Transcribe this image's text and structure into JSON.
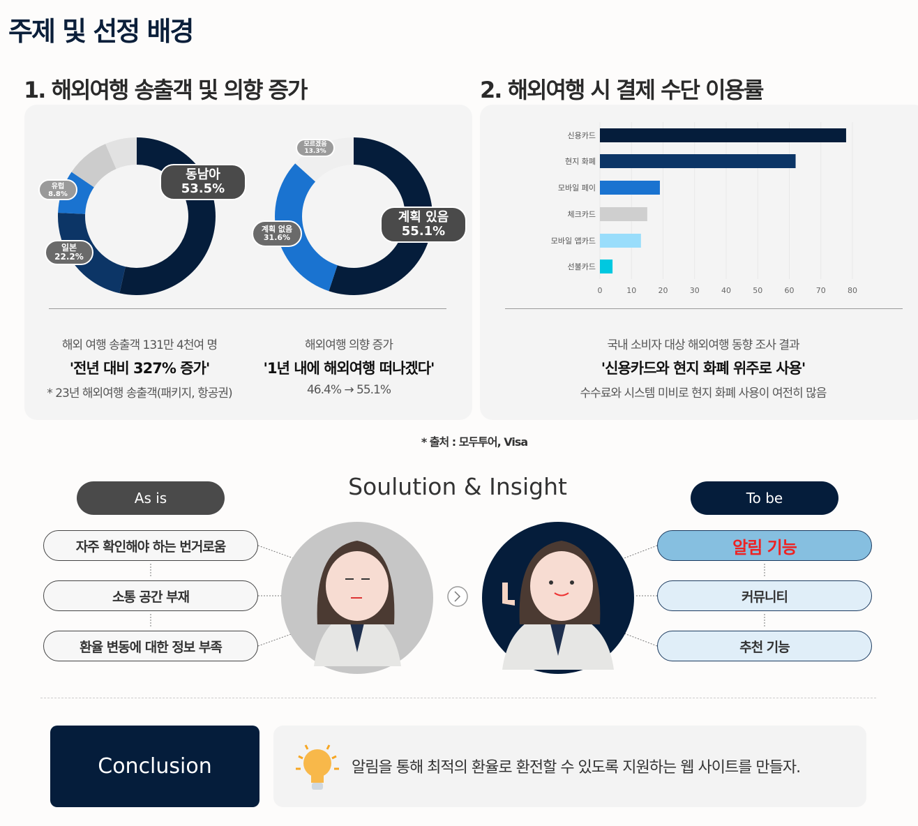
{
  "title": "주제 및 선정 배경",
  "section1": {
    "heading": "1. 해외여행 송출객 및 의향 증가",
    "left_caption": "해외 여행 송출객 131만 4천여 명",
    "left_highlight": "'전년 대비 327% 증가'",
    "left_note": "* 23년 해외여행 송출객(패키지, 항공권)",
    "right_caption": "해외여행 의향 증가",
    "right_highlight": "'1년 내에 해외여행 떠나겠다'",
    "right_note": "46.4% → 55.1%"
  },
  "section2": {
    "heading": "2. 해외여행 시 결제 수단 이용률",
    "caption": "국내 소비자 대상 해외여행 동향 조사 결과",
    "highlight": "'신용카드와 현지 화폐 위주로 사용'",
    "note": "수수료와 시스템 미비로 현지 화폐 사용이 여전히 많음"
  },
  "source": "* 출처 : 모두투어, Visa",
  "chart_data": [
    {
      "type": "pie",
      "donut": true,
      "labels": [
        "동남아",
        "일본",
        "유럽",
        "",
        ""
      ],
      "values": [
        53.5,
        22.2,
        8.8,
        9,
        6.5
      ],
      "value_labels": [
        "53.5%",
        "22.2%",
        "8.8%",
        "",
        ""
      ],
      "colors": [
        "#051d3b",
        "#0c3566",
        "#1a73d0",
        "#cccccc",
        "#e2e2e2"
      ]
    },
    {
      "type": "pie",
      "donut": true,
      "labels": [
        "계획 있음",
        "계획 없음",
        "모르겠음"
      ],
      "values": [
        55.1,
        31.6,
        13.3
      ],
      "value_labels": [
        "55.1%",
        "31.6%",
        "13.3%"
      ],
      "colors": [
        "#051d3b",
        "#1a73d0",
        "#efefef"
      ]
    },
    {
      "type": "bar",
      "orientation": "horizontal",
      "categories": [
        "신용카드",
        "현지 화폐",
        "모바일 페이",
        "체크카드",
        "모바일 앱카드",
        "선불카드"
      ],
      "values": [
        78,
        62,
        19,
        15,
        13,
        4
      ],
      "colors": [
        "#051d3b",
        "#0c3566",
        "#1a73d0",
        "#cfcfcf",
        "#99ddfb",
        "#00c8e0"
      ],
      "xlim": [
        0,
        80
      ],
      "xticks": [
        "0",
        "10",
        "20",
        "30",
        "40",
        "50",
        "60",
        "70",
        "80"
      ],
      "grid": true
    }
  ],
  "insight": {
    "title": "Soulution & Insight",
    "as_is_label": "As is",
    "to_be_label": "To be",
    "as_is": [
      "자주 확인해야 하는 번거로움",
      "소통 공간 부재",
      "환율 변동에 대한 정보 부족"
    ],
    "to_be": [
      "알림 기능",
      "커뮤니티",
      "추천 기능"
    ],
    "highlight_color": "#ee2222"
  },
  "conclusion": {
    "label": "Conclusion",
    "text": "알림을 통해 최적의 환율로 환전할 수 있도록 지원하는 웹 사이트를 만들자."
  }
}
